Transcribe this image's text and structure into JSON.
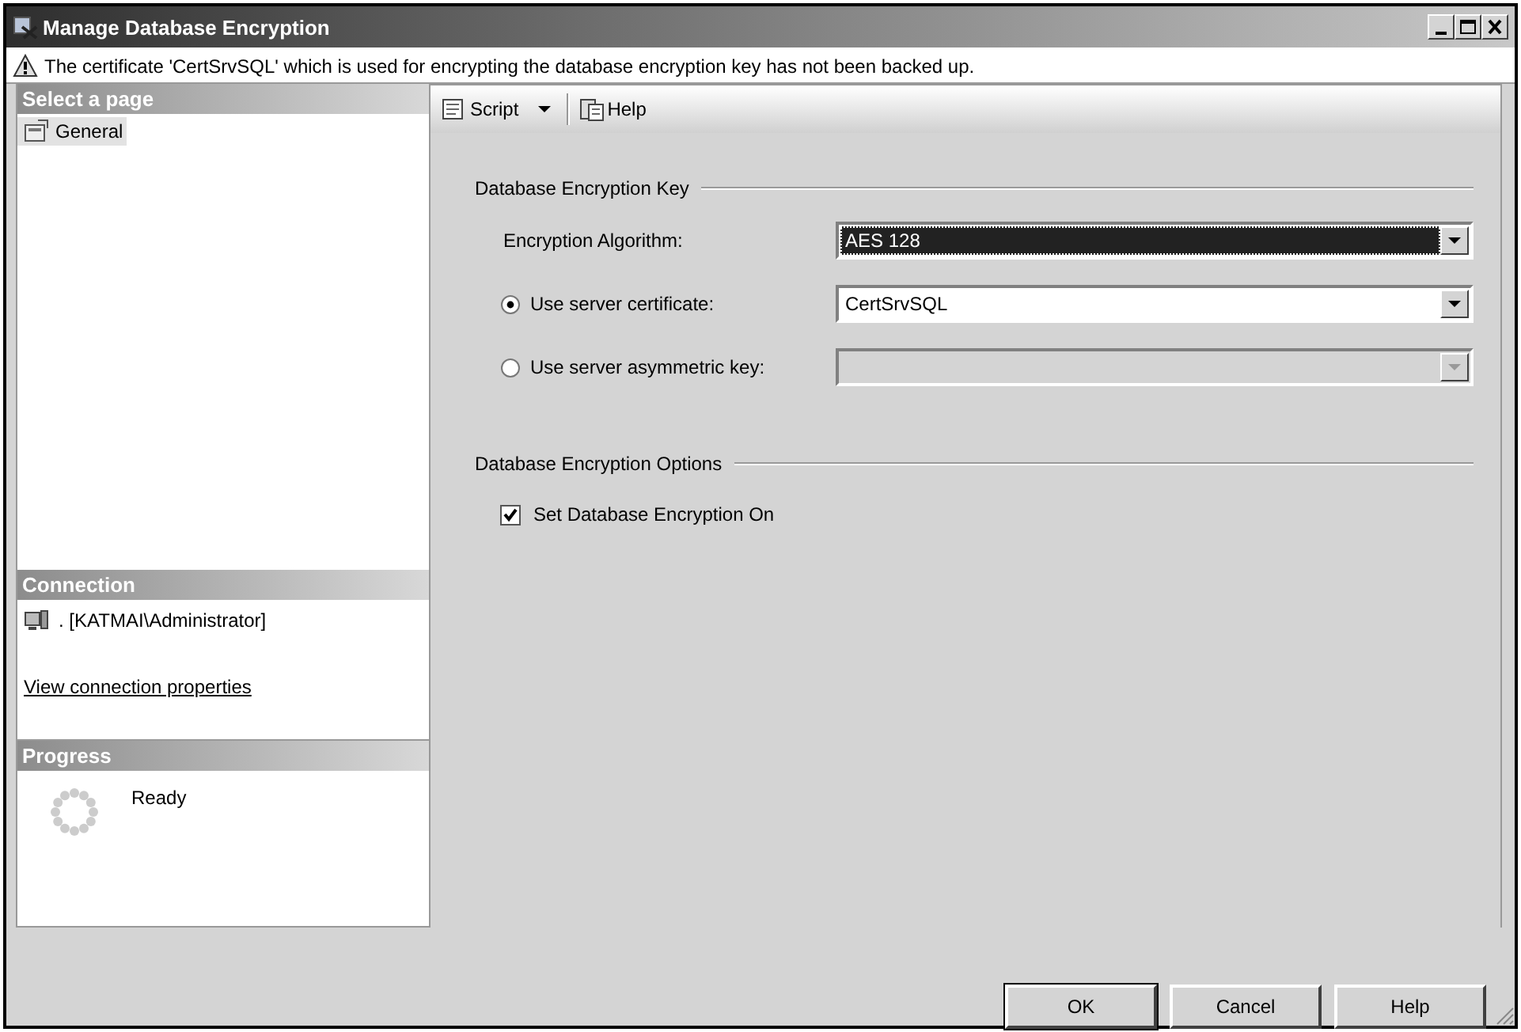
{
  "window": {
    "title": "Manage Database Encryption"
  },
  "warning": {
    "text": "The certificate 'CertSrvSQL' which is used for encrypting the database encryption key has not been backed up."
  },
  "select_page": {
    "header": "Select a page",
    "items": [
      {
        "label": "General",
        "selected": true
      }
    ]
  },
  "connection": {
    "header": "Connection",
    "server": ". [KATMAI\\Administrator]",
    "link": "View connection properties"
  },
  "progress": {
    "header": "Progress",
    "status": "Ready"
  },
  "toolbar": {
    "items": [
      {
        "label": "Script",
        "kind": "dropdown"
      },
      {
        "label": "Help",
        "kind": "button"
      }
    ]
  },
  "groups": [
    {
      "title": "Database Encryption Key",
      "rows": [
        {
          "kind": "combo",
          "label": "Encryption Algorithm:",
          "value": "AES 128",
          "focused": true
        },
        {
          "kind": "radio-combo",
          "label": "Use server certificate:",
          "selected": true,
          "value": "CertSrvSQL",
          "disabled": false
        },
        {
          "kind": "radio-combo",
          "label": "Use server asymmetric key:",
          "selected": false,
          "disabled": true
        }
      ]
    },
    {
      "title": "Database Encryption Options",
      "rows": [
        {
          "kind": "checkbox",
          "label": "Set Database Encryption On",
          "checked": true
        }
      ]
    }
  ],
  "buttons": [
    {
      "label": "OK",
      "default": true
    },
    {
      "label": "Cancel",
      "default": false
    },
    {
      "label": "Help",
      "default": false
    }
  ]
}
